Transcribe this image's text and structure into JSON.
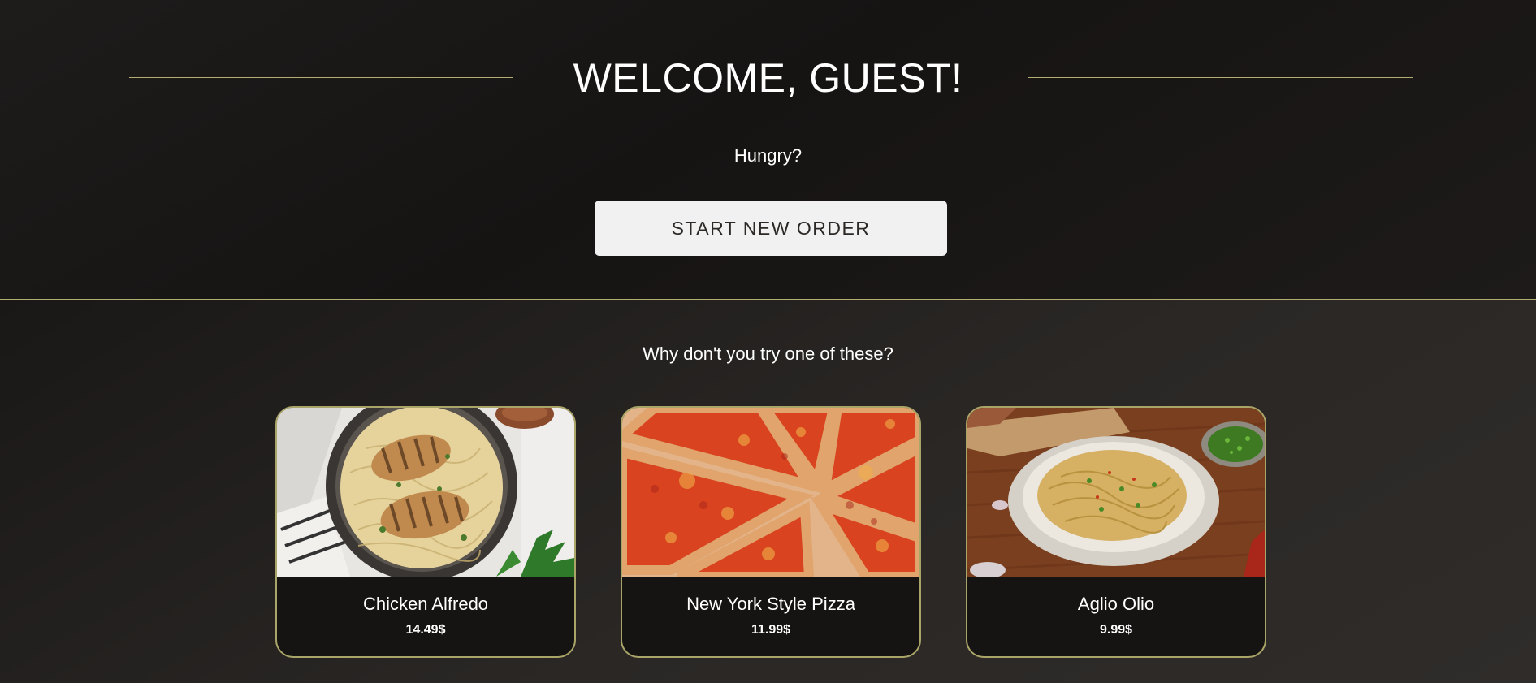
{
  "hero": {
    "title": "WELCOME, GUEST!",
    "subtitle": "Hungry?",
    "start_button_label": "START NEW ORDER"
  },
  "featured": {
    "heading": "Why don't you try one of these?",
    "items": [
      {
        "name": "Chicken Alfredo",
        "price": "14.49$",
        "image": "chicken-alfredo-photo"
      },
      {
        "name": "New York Style Pizza",
        "price": "11.99$",
        "image": "pizza-photo"
      },
      {
        "name": "Aglio Olio",
        "price": "9.99$",
        "image": "aglio-olio-photo"
      }
    ]
  },
  "colors": {
    "accent": "#b3ad70",
    "background": "#1b1918",
    "button_bg": "#f1f1f1",
    "card_bg": "#161413"
  }
}
